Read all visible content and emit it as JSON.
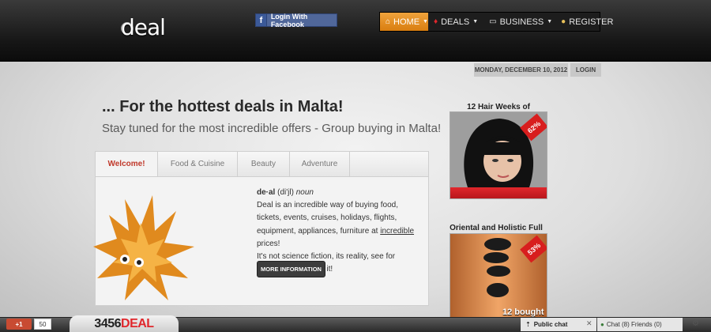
{
  "header": {
    "logo": "deal",
    "facebook_login": "Login With Facebook",
    "nav": {
      "home": "HOME",
      "deals": "DEALS",
      "business": "BUSINESS",
      "register": "REGISTER"
    },
    "date": "MONDAY, DECEMBER 10, 2012",
    "login": "LOGIN"
  },
  "main": {
    "headline": "... For the hottest deals in Malta!",
    "subheadline": "Stay tuned for the most incredible offers - Group buying in Malta!",
    "tabs": [
      {
        "label": "Welcome!"
      },
      {
        "label": "Food & Cuisine"
      },
      {
        "label": "Beauty"
      },
      {
        "label": "Adventure"
      }
    ],
    "definition": {
      "word": "de·al",
      "pronunciation": "(di'jl)",
      "pos": "noun",
      "line1": "Deal is an incredible way of buying food, tickets, events, cruises, holidays, flights, equipment, appliances, furniture at",
      "incredible": "incredible",
      "prices": "prices!",
      "line2": "It's not science fiction, its reality, see for yourself how we do it!"
    },
    "more_button": "MORE INFORMATION"
  },
  "sidebar": {
    "deals": [
      {
        "title": "12 Hair Weeks of",
        "discount": "62%"
      },
      {
        "title": "Oriental and Holistic Full",
        "discount": "53%",
        "bought": "12 bought"
      }
    ]
  },
  "footer": {
    "gplus": "+1",
    "gplus_count": "50",
    "brand_digits": "3456",
    "brand_word": "DEAL",
    "public_chat": "Public chat",
    "chat_friends": "Chat (8) Friends (0)"
  },
  "colors": {
    "accent_orange": "#e8901f",
    "deal_red": "#d81e1e",
    "header_dark": "#161616"
  }
}
